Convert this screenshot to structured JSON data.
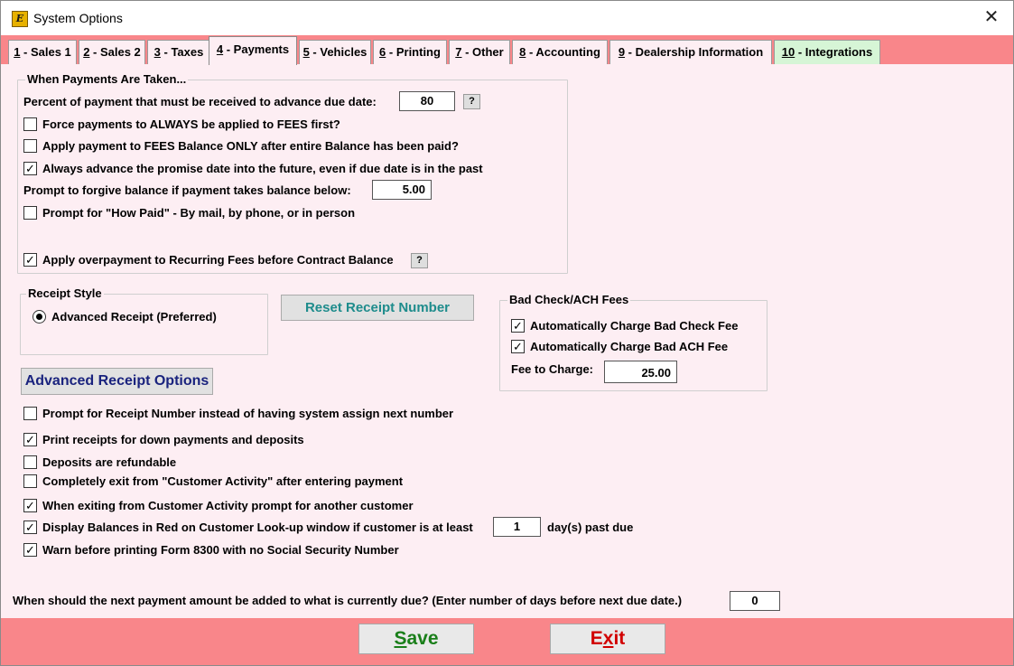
{
  "window": {
    "title": "System Options",
    "close_icon": "close-icon"
  },
  "tabs": [
    {
      "num": "1",
      "label": " - Sales 1"
    },
    {
      "num": "2",
      "label": " - Sales 2"
    },
    {
      "num": "3",
      "label": " - Taxes"
    },
    {
      "num": "4",
      "label": " - Payments"
    },
    {
      "num": "5",
      "label": " - Vehicles"
    },
    {
      "num": "6",
      "label": " - Printing"
    },
    {
      "num": "7",
      "label": " - Other"
    },
    {
      "num": "8",
      "label": " - Accounting"
    },
    {
      "num": "9",
      "label": " - Dealership Information"
    },
    {
      "num": "10",
      "label": " - Integrations"
    }
  ],
  "payments_group": {
    "title": "When Payments Are Taken...",
    "percent_label": "Percent of payment that must be received to advance due date:",
    "percent_value": "80",
    "help": "?",
    "force_fees": {
      "label": "Force payments to ALWAYS be applied to FEES first?",
      "checked": false
    },
    "fees_after": {
      "label": "Apply payment to FEES Balance ONLY after entire Balance has been paid?",
      "checked": false
    },
    "advance_promise": {
      "label": "Always advance the promise date into the future, even if due date is in the past",
      "checked": true
    },
    "forgive_label": "Prompt to forgive balance if payment takes balance below:",
    "forgive_value": "5.00",
    "how_paid": {
      "label": "Prompt for \"How Paid\" - By mail, by phone, or in person",
      "checked": false
    },
    "overpayment": {
      "label": "Apply overpayment to Recurring Fees before Contract Balance",
      "checked": true
    }
  },
  "receipt_style": {
    "title": "Receipt Style",
    "option": "Advanced Receipt (Preferred)"
  },
  "reset_receipt_button": "Reset Receipt Number",
  "bad_check": {
    "title": "Bad Check/ACH Fees",
    "check_fee": {
      "label": "Automatically Charge Bad Check Fee",
      "checked": true
    },
    "ach_fee": {
      "label": "Automatically Charge Bad ACH Fee",
      "checked": true
    },
    "fee_label": "Fee to Charge:",
    "fee_value": "25.00"
  },
  "advanced_receipt_button": "Advanced Receipt Options",
  "options": {
    "prompt_receipt": {
      "label": "Prompt for Receipt Number instead of having system assign next number",
      "checked": false
    },
    "print_receipts": {
      "label": "Print receipts for down payments and deposits",
      "checked": true
    },
    "deposits_refundable": {
      "label": "Deposits are refundable",
      "checked": false
    },
    "exit_activity": {
      "label": "Completely exit from \"Customer Activity\" after entering payment",
      "checked": false
    },
    "prompt_another": {
      "label": "When exiting from Customer Activity prompt for another customer",
      "checked": true
    },
    "display_red": {
      "label": "Display Balances in Red on Customer Look-up window if customer is at least",
      "checked": true,
      "value": "1",
      "suffix": "day(s) past due"
    },
    "warn_8300": {
      "label": "Warn before printing Form 8300 with no Social Security Number",
      "checked": true
    }
  },
  "next_payment_label": "When should the next payment amount be added to what is currently due? (Enter number of days before next due date.)",
  "next_payment_value": "0",
  "footer": {
    "save_first": "S",
    "save_rest": "ave",
    "exit_first": "E",
    "exit_x": "x",
    "exit_rest": "it",
    "save_color": "#1a7f1a",
    "exit_color": "#d10000"
  }
}
